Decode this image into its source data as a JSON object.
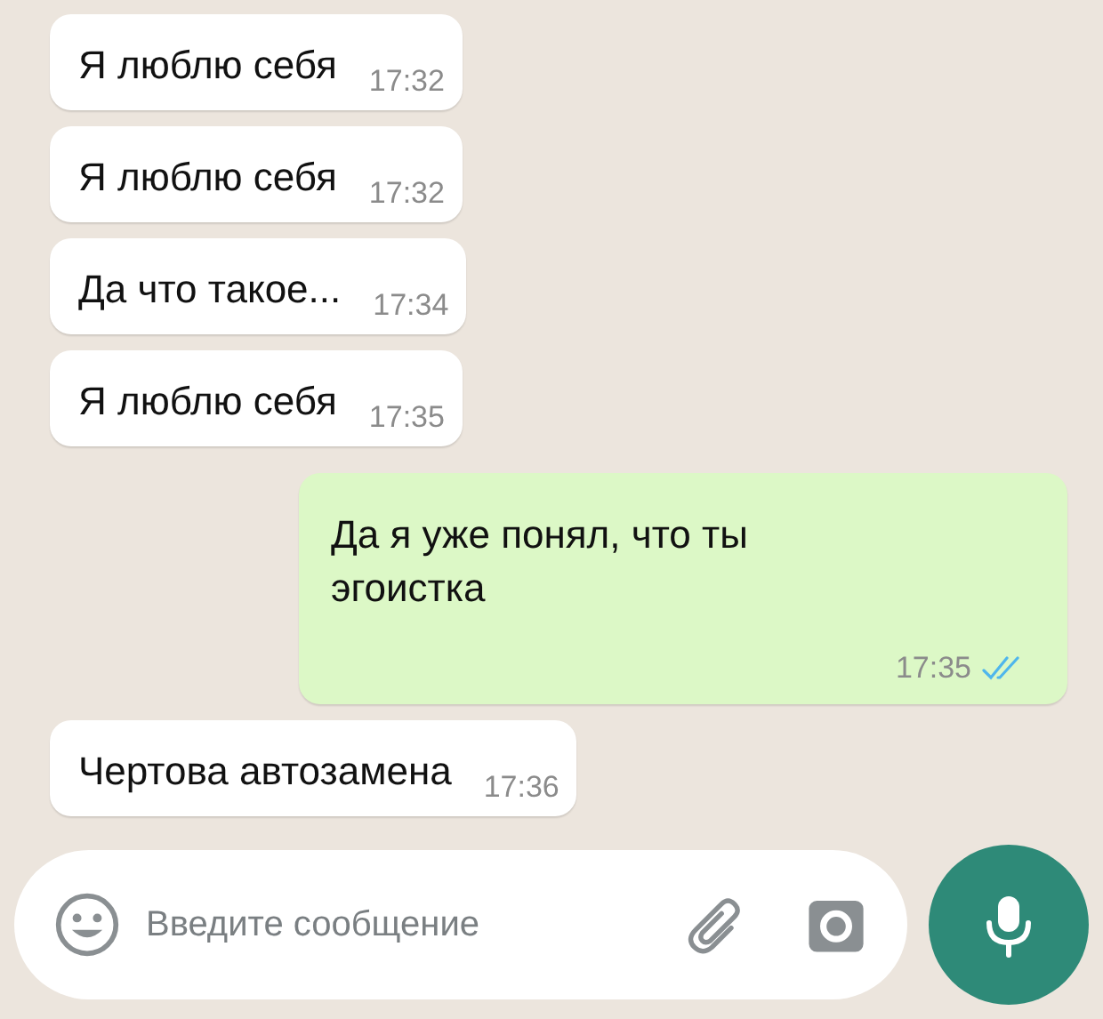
{
  "messages": [
    {
      "kind": "incoming",
      "text": "Я люблю себя",
      "time": "17:32"
    },
    {
      "kind": "incoming",
      "text": "Я люблю себя",
      "time": "17:32"
    },
    {
      "kind": "incoming",
      "text": "Да что такое...",
      "time": "17:34"
    },
    {
      "kind": "incoming",
      "text": "Я люблю себя",
      "time": "17:35"
    },
    {
      "kind": "outgoing",
      "text": "Да я уже понял, что ты эгоистка",
      "time": "17:35",
      "read": true
    },
    {
      "kind": "incoming",
      "text": "Чертова автозамена",
      "time": "17:36"
    }
  ],
  "composer": {
    "placeholder": "Введите сообщение"
  }
}
